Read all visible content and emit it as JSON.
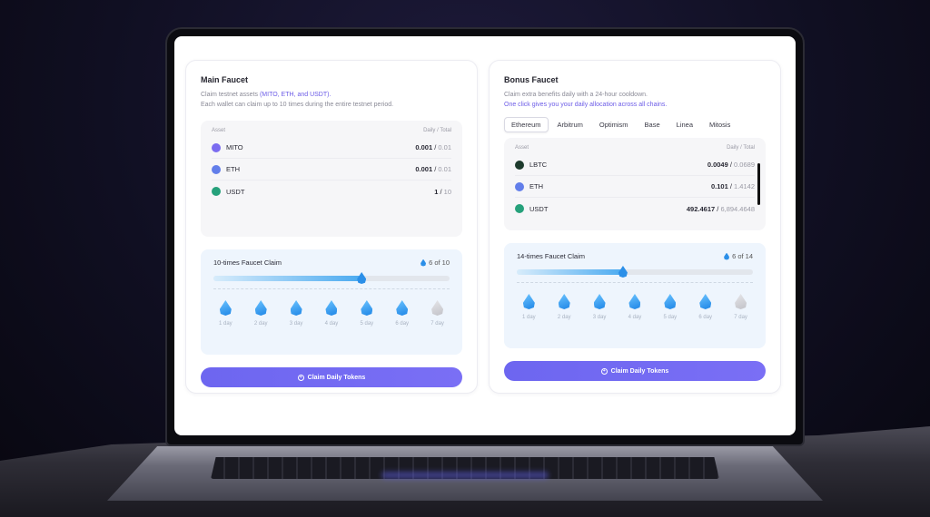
{
  "main": {
    "title": "Main Faucet",
    "desc_prefix": "Claim testnet assets ",
    "desc_highlight": "(MITO, ETH, and USDT).",
    "desc_line2": "Each wallet can claim up to 10 times during the entire testnet period.",
    "col_asset": "Asset",
    "col_amount": "Daily / Total",
    "assets": [
      {
        "name": "MITO",
        "daily": "0.001",
        "total": "0.01",
        "icon": "mito-icon",
        "color": "#7b6cf0"
      },
      {
        "name": "ETH",
        "daily": "0.001",
        "total": "0.01",
        "icon": "eth-icon",
        "color": "#627eea"
      },
      {
        "name": "USDT",
        "daily": "1",
        "total": "10",
        "icon": "usdt-icon",
        "color": "#26a17b"
      }
    ],
    "claim_title": "10-times Faucet Claim",
    "claim_count": "6 of 10",
    "progress": 0.6,
    "days": [
      "1 day",
      "2 day",
      "3 day",
      "4 day",
      "5 day",
      "6 day",
      "7 day"
    ],
    "button": "Claim Daily Tokens"
  },
  "bonus": {
    "title": "Bonus Faucet",
    "desc_line1": "Claim extra benefits daily with a 24-hour cooldown.",
    "desc_line2": "One click gives you your daily allocation across all chains.",
    "tabs": [
      "Ethereum",
      "Arbitrum",
      "Optimism",
      "Base",
      "Linea",
      "Mitosis"
    ],
    "active_tab": "Ethereum",
    "col_asset": "Asset",
    "col_amount": "Daily / Total",
    "assets": [
      {
        "name": "LBTC",
        "daily": "0.0049",
        "total": "0.0689",
        "icon": "lbtc-icon",
        "color": "#1e3b2d"
      },
      {
        "name": "ETH",
        "daily": "0.101",
        "total": "1.4142",
        "icon": "eth-icon",
        "color": "#627eea"
      },
      {
        "name": "USDT",
        "daily": "492.4617",
        "total": "6,894.4648",
        "icon": "usdt-icon",
        "color": "#26a17b"
      }
    ],
    "claim_title": "14-times Faucet Claim",
    "claim_count": "6 of 14",
    "progress": 0.43,
    "days": [
      "1 day",
      "2 day",
      "3 day",
      "4 day",
      "5 day",
      "6 day",
      "7 day"
    ],
    "button": "Claim Daily Tokens"
  },
  "colors": {
    "accent": "#6d66f0",
    "drop_blue": "#1f86e6"
  }
}
